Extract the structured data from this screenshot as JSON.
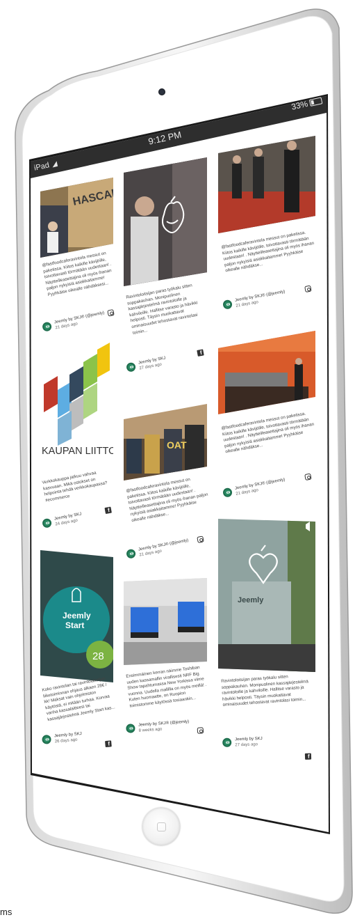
{
  "status_bar": {
    "device": "iPad",
    "time": "9:12 PM",
    "battery": "33%"
  },
  "cards": [
    {
      "id": "c1",
      "text": "@fastfoodcaferavintola messut on paketissa. Kiitos kaikille kävijöille, toivottavasti törmätään uudestaan! . Näytteilleasettajina oli myös ihanan paljon nykyisiä asiakkaitamme! Pyyhkäise oikealle nähdäksesi...",
      "author": "Jeemly by SKJ® (@jeemly)",
      "ago": "21 days ago",
      "network": "instagram-icon",
      "image_caption": "HASCAN"
    },
    {
      "id": "c2",
      "text": "Ravintoloitsijan paras työkalu sitten soppakauhan. Monipuolinen kassajärjestelmä ravintoloille ja kahviloille. Hallitse varasto ja hävikki helposti. Täysin muokattavat ominaisuudet tehostavat ravintolasi toimin...",
      "author": "Jeemly by SKJ",
      "ago": "27 days ago",
      "network": "facebook-icon"
    },
    {
      "id": "c3",
      "text": "@fastfoodcaferavintola messut on paketissa. Kiitos kaikille kävijöille, toivottavasti törmätään uudestaan! . Näytteilleasettajina oli myös ihanan paljon nykyisiä asiakkaitamme! Pyyhkäise oikealle nähdäkse...",
      "author": "Jeemly by SKJ® (@jeemly)",
      "ago": "21 days ago",
      "network": "instagram-icon"
    },
    {
      "id": "c4",
      "text": "Verkkokauppa jatkuu vahvaa kasvuaan. Mikä ostokset on helpointa tehdä verkkokaupassa? #ecommerce",
      "author": "Jeemly by SKJ",
      "ago": "24 days ago",
      "network": "facebook-icon",
      "image_caption": "KAUPAN LIITTO"
    },
    {
      "id": "c5",
      "text": "@fastfoodcaferavintola messut on paketissa. Kiitos kaikille kävijöille, toivottavasti törmätään uudestaan! . Näytteilleasettajina oli myös ihanan paljon nykyisiä asiakkaitamme! Pyyhkäise oikealle nähdäkse...",
      "author": "Jeemly by SKJ® (@jeemly)",
      "ago": "21 days ago",
      "network": "instagram-icon"
    },
    {
      "id": "c6",
      "text": "@fastfoodcaferavintola messut on paketissa. Kiitos kaikille kävijöille, toivottavasti törmätään uudestaan! . Näytteilleasettajina oli myös ihanan paljon nykyisiä asiakkaitamme! Pyyhkäise oikealle nähdäkse...",
      "author": "Jeemly by SKJ® (@jeemly)",
      "ago": "21 days ago",
      "network": "instagram-icon"
    },
    {
      "id": "c7",
      "text": "Koko ravintolan tai ravintolaketjun liiketoiminnan ohjaus alkaen 28€ / kk! Maksat vain ohjelmiston käytöstä, ei mitään turhaa. Korvaa vanha kassalaitteesi tai kassajärjestelmä Jeemly Start kas...",
      "author": "Jeemly by SKJ",
      "ago": "26 days ago",
      "network": "facebook-icon",
      "image_title": "Jeemly",
      "image_subtitle": "Start",
      "price": "28"
    },
    {
      "id": "c8",
      "text": "Ensimmäinen kerran näimme Toshiban uuden kassamallin virallisesti NRF Big Show tapahtumassa New Yorkissa viime vuonna. Uudella mallilla on myös meillä! . Kuten huomaatte, on Ruopion toimistomme käytössä tosiaankin...",
      "author": "Jeemly by SKJ® (@jeemly)",
      "ago": "8 weeks ago",
      "network": "instagram-icon"
    },
    {
      "id": "c9",
      "text": "Ravintoloitsijan paras työkalu sitten soppakauhan. Monipuolinen kassajärjestelmä ravintoloille ja kahviloille. Hallitse varasto ja hävikki helposti. Täysin muokattavat ominaisuudet tehostavat ravintolasi toimin...",
      "author": "Jeemly by SKJ",
      "ago": "27 days ago",
      "network": "facebook-icon"
    }
  ],
  "footer_label": "ms"
}
